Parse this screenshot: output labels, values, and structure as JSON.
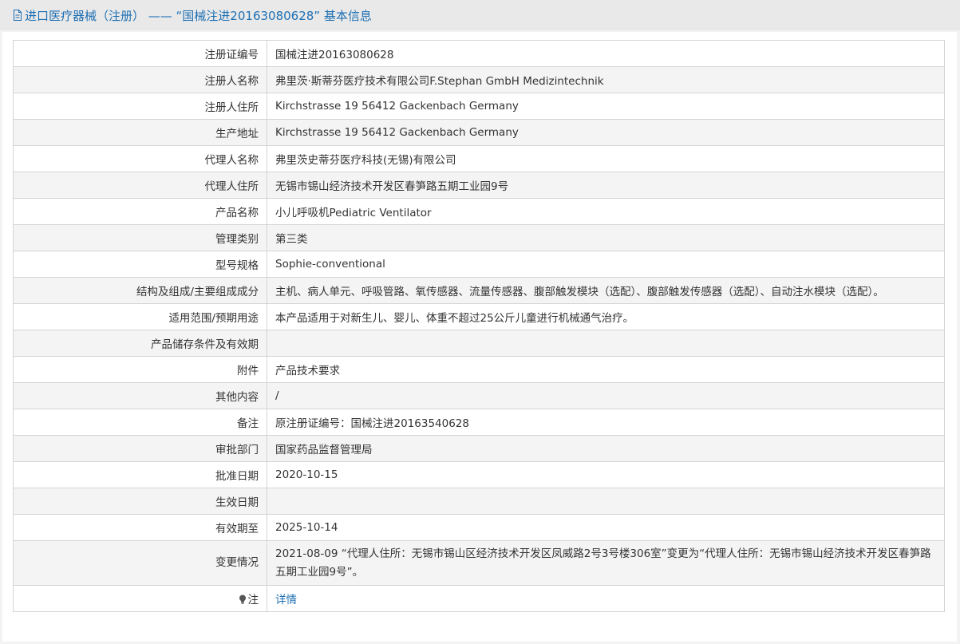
{
  "header": {
    "title": "进口医疗器械（注册） —— “国械注进20163080628” 基本信息",
    "icon": "document-icon"
  },
  "rows": [
    {
      "label": "注册证编号",
      "value": "国械注进20163080628"
    },
    {
      "label": "注册人名称",
      "value": "弗里茨·斯蒂芬医疗技术有限公司F.Stephan GmbH Medizintechnik"
    },
    {
      "label": "注册人住所",
      "value": "Kirchstrasse 19 56412 Gackenbach Germany"
    },
    {
      "label": "生产地址",
      "value": "Kirchstrasse 19 56412 Gackenbach Germany"
    },
    {
      "label": "代理人名称",
      "value": "弗里茨史蒂芬医疗科技(无锡)有限公司"
    },
    {
      "label": "代理人住所",
      "value": "无锡市锡山经济技术开发区春笋路五期工业园9号"
    },
    {
      "label": "产品名称",
      "value": "小儿呼吸机Pediatric Ventilator"
    },
    {
      "label": "管理类别",
      "value": "第三类"
    },
    {
      "label": "型号规格",
      "value": "Sophie-conventional"
    },
    {
      "label": "结构及组成/主要组成成分",
      "value": "主机、病人单元、呼吸管路、氧传感器、流量传感器、腹部触发模块（选配）、腹部触发传感器（选配）、自动注水模块（选配）。"
    },
    {
      "label": "适用范围/预期用途",
      "value": "本产品适用于对新生儿、婴儿、体重不超过25公斤儿童进行机械通气治疗。"
    },
    {
      "label": "产品储存条件及有效期",
      "value": ""
    },
    {
      "label": "附件",
      "value": "产品技术要求"
    },
    {
      "label": "其他内容",
      "value": "/"
    },
    {
      "label": "备注",
      "value": "原注册证编号：国械注进20163540628"
    },
    {
      "label": "审批部门",
      "value": "国家药品监督管理局"
    },
    {
      "label": "批准日期",
      "value": "2020-10-15"
    },
    {
      "label": "生效日期",
      "value": ""
    },
    {
      "label": "有效期至",
      "value": "2025-10-14"
    },
    {
      "label": "变更情况",
      "value": "2021-08-09 “代理人住所：无锡市锡山区经济技术开发区凤威路2号3号楼306室”变更为“代理人住所：无锡市锡山经济技术开发区春笋路五期工业园9号”。"
    }
  ],
  "note": {
    "label": "注",
    "icon": "lightbulb-icon",
    "link_text": "详情"
  }
}
